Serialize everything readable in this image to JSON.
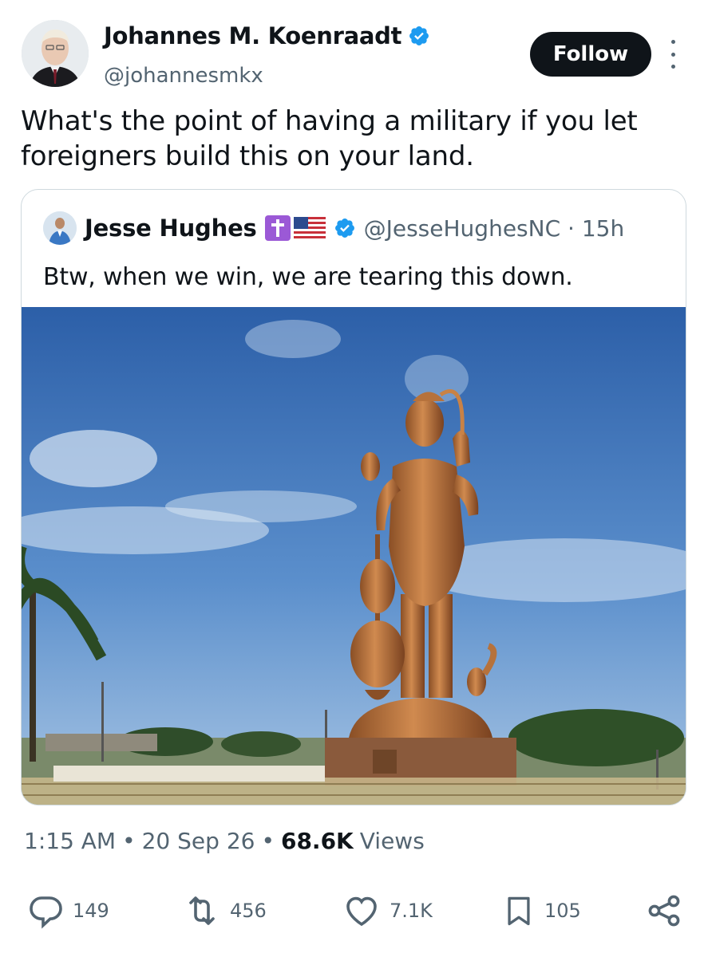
{
  "author": {
    "display_name": "Johannes M. Koenraadt",
    "handle": "@johannesmkx",
    "verified": true,
    "follow_label": "Follow"
  },
  "tweet": {
    "text": "What's the point of having a military if you let foreigners build this on your land."
  },
  "quoted": {
    "display_name": "Jesse Hughes",
    "emojis": [
      "latin-cross-emoji",
      "us-flag-emoji"
    ],
    "handle_time": "@JesseHughesNC · 15h",
    "text": "Btw, when we win, we are tearing this down.",
    "image": "tall-copper-statue-under-blue-sky-photo"
  },
  "meta": {
    "time": "1:15 AM",
    "sep1": "•",
    "date": "20 Sep 26",
    "sep2": "•",
    "views_count": "68.6K",
    "views_label": "Views"
  },
  "actions": {
    "replies": "149",
    "reposts": "456",
    "likes": "7.1K",
    "bookmarks": "105"
  },
  "colors": {
    "text": "#0f1419",
    "secondary": "#536471",
    "verified_blue": "#1d9bf0",
    "follow_bg": "#0f1419",
    "border": "#cfd9de"
  }
}
